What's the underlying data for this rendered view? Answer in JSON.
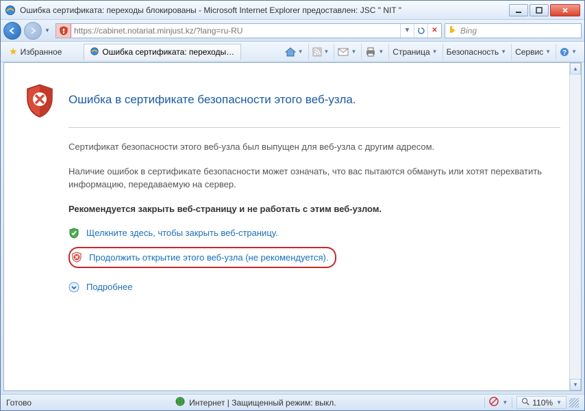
{
  "window": {
    "title": "Ошибка сертификата: переходы блокированы - Microsoft Internet Explorer предоставлен: JSC  \" NIT \""
  },
  "address": {
    "url": "https://cabinet.notariat.minjust.kz/?lang=ru-RU"
  },
  "search": {
    "placeholder": "Bing"
  },
  "favorites": {
    "label": "Избранное"
  },
  "tab": {
    "title": "Ошибка сертификата: переходы бл..."
  },
  "toolbar": {
    "page": "Страница",
    "security": "Безопасность",
    "tools": "Сервис"
  },
  "cert": {
    "heading": "Ошибка в сертификате безопасности этого веб-узла.",
    "line1": "Сертификат безопасности этого веб-узла был выпущен для веб-узла с другим адресом.",
    "line2": "Наличие ошибок в сертификате безопасности может означать, что вас пытаются обмануть или хотят перехватить информацию, передаваемую на сервер.",
    "recommendation": "Рекомендуется закрыть веб-страницу и не работать с этим веб-узлом.",
    "close_link": "Щелкните здесь, чтобы закрыть веб-страницу.",
    "continue_link": "Продолжить открытие этого веб-узла (не рекомендуется).",
    "more_link": "Подробнее"
  },
  "status": {
    "ready": "Готово",
    "zone": "Интернет | Защищенный режим: выкл.",
    "zoom": "110%"
  }
}
